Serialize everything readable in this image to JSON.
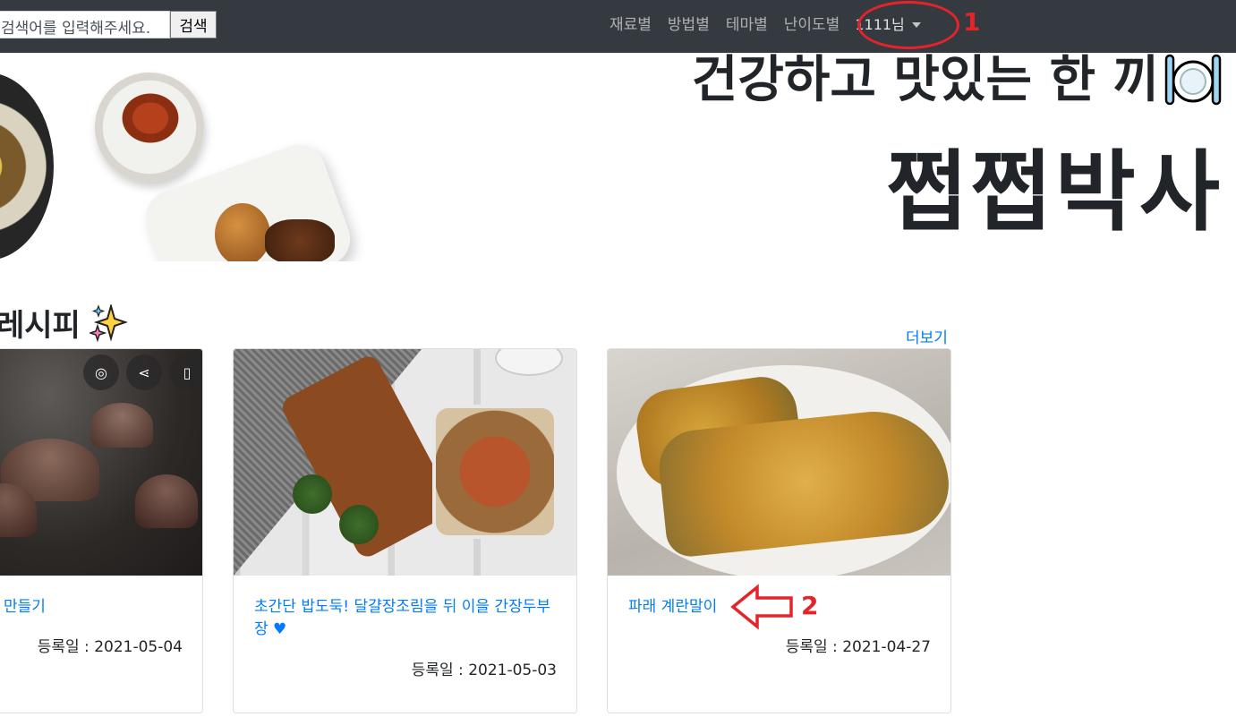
{
  "navbar": {
    "search_placeholder": "검색어를 입력해주세요.",
    "search_button": "검색",
    "links": [
      "재료별",
      "방법별",
      "테마별",
      "난이도별"
    ],
    "user_label": "1111님"
  },
  "annotations": {
    "marker1": "1",
    "marker2": "2"
  },
  "hero": {
    "subtitle": "건강하고 맛있는 한 끼",
    "title": "쩝쩝박사"
  },
  "section": {
    "title": "레시피",
    "more": "더보기"
  },
  "cards": [
    {
      "title": "만들기",
      "date": "등록일 : 2021-05-04"
    },
    {
      "title": "초간단 밥도둑! 달걀장조림을 뒤 이을 간장두부장 ♥",
      "date": "등록일 : 2021-05-03"
    },
    {
      "title": "파래 계란말이",
      "date": "등록일 : 2021-04-27"
    }
  ],
  "colors": {
    "navbar": "#343a40",
    "link": "#007bff",
    "annotation": "#e3242b"
  }
}
